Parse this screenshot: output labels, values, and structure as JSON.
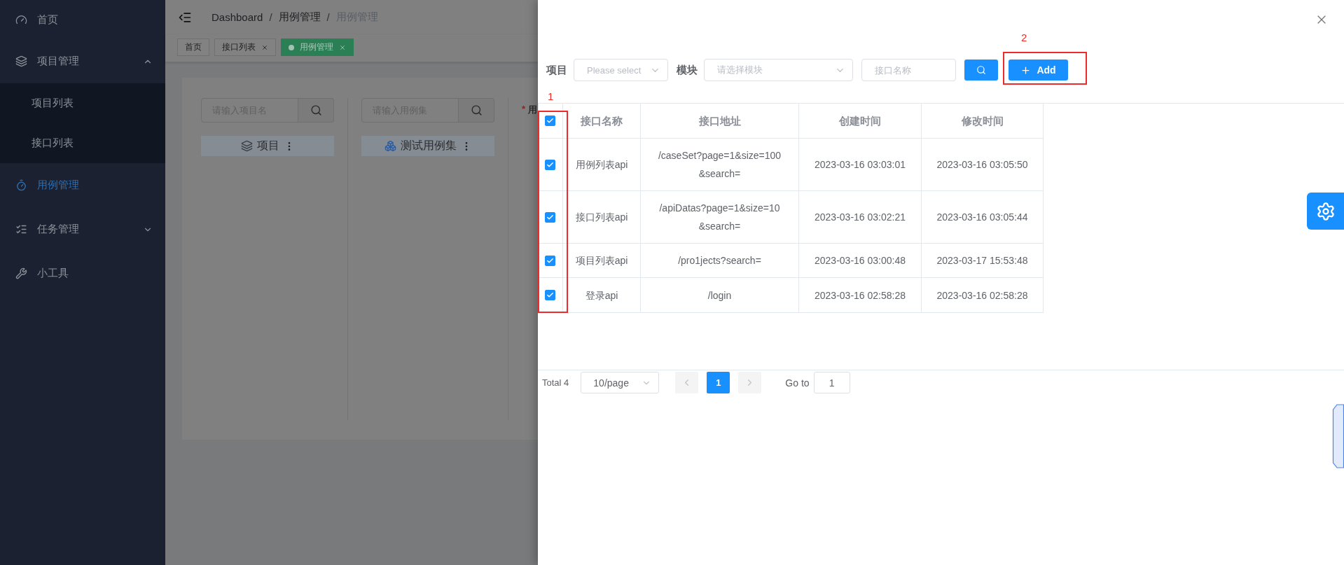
{
  "sidebar": {
    "items": [
      {
        "kind": "item",
        "label": "首页",
        "selected": false
      },
      {
        "kind": "submenu",
        "label": "项目管理",
        "selected": false,
        "expanded": true,
        "children": [
          {
            "label": "项目列表",
            "selected": false
          },
          {
            "label": "接口列表",
            "selected": false
          }
        ]
      },
      {
        "kind": "item",
        "label": "用例管理",
        "selected": true
      },
      {
        "kind": "submenu",
        "label": "任务管理",
        "selected": false,
        "expanded": false
      },
      {
        "kind": "item",
        "label": "小工具",
        "selected": false
      }
    ]
  },
  "main": {
    "breadcrumb": {
      "separator": "/",
      "items": [
        "Dashboard",
        "用例管理",
        "用例管理"
      ]
    },
    "tabs": [
      {
        "label": "首页",
        "selected": false,
        "closable": false
      },
      {
        "label": "接口列表",
        "selected": false,
        "closable": true
      },
      {
        "label": "用例管理",
        "selected": true,
        "closable": true
      }
    ],
    "panels": [
      {
        "placeholder": "请输入项目名",
        "heading": "项目"
      },
      {
        "placeholder": "请输入用例集",
        "heading": "测试用例集"
      }
    ],
    "form_label": {
      "required_mark": "*",
      "text": "用"
    }
  },
  "drawer": {
    "filters": {
      "project_label": "项目",
      "project_placeholder": "Please select",
      "module_label": "模块",
      "module_placeholder": "请选择模块",
      "name_placeholder": "接口名称"
    },
    "add_button": "Add",
    "table": {
      "header_checked": true,
      "columns": [
        "接口名称",
        "接口地址",
        "创建时间",
        "修改时间"
      ],
      "rows": [
        {
          "checked": true,
          "cells": [
            "用例列表api",
            "/caseSet?page=1&size=100&search=",
            "2023-03-16 03:03:01",
            "2023-03-16 03:05:50"
          ]
        },
        {
          "checked": true,
          "cells": [
            "接口列表api",
            "/apiDatas?page=1&size=10&search=",
            "2023-03-16 03:02:21",
            "2023-03-16 03:05:44"
          ]
        },
        {
          "checked": true,
          "cells": [
            "项目列表api",
            "/pro1jects?search=",
            "2023-03-16 03:00:48",
            "2023-03-17 15:53:48"
          ]
        },
        {
          "checked": true,
          "cells": [
            "登录api",
            "/login",
            "2023-03-16 02:58:28",
            "2023-03-16 02:58:28"
          ]
        }
      ]
    },
    "pagination": {
      "total": "Total 4",
      "page_size": "10/page",
      "pages": [
        {
          "label": "1",
          "selected": true
        }
      ],
      "goto_label": "Go to",
      "goto_value": "1"
    }
  },
  "annotations": [
    {
      "label": "1"
    },
    {
      "label": "2"
    }
  ]
}
